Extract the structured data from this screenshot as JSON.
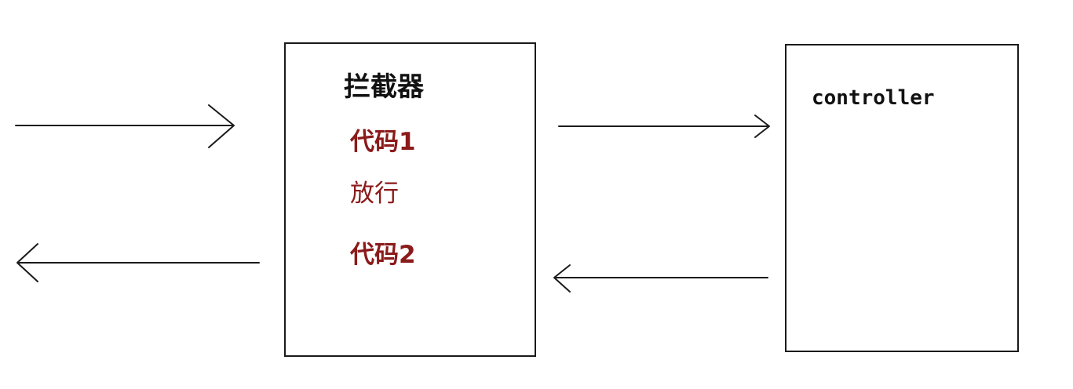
{
  "colors": {
    "line": "#1a1a1a",
    "text_dark": "#111111",
    "text_accent": "#8b1a1a"
  },
  "interceptor": {
    "title": "拦截器",
    "code1": "代码1",
    "pass": "放行",
    "code2": "代码2"
  },
  "controller": {
    "label": "controller"
  }
}
